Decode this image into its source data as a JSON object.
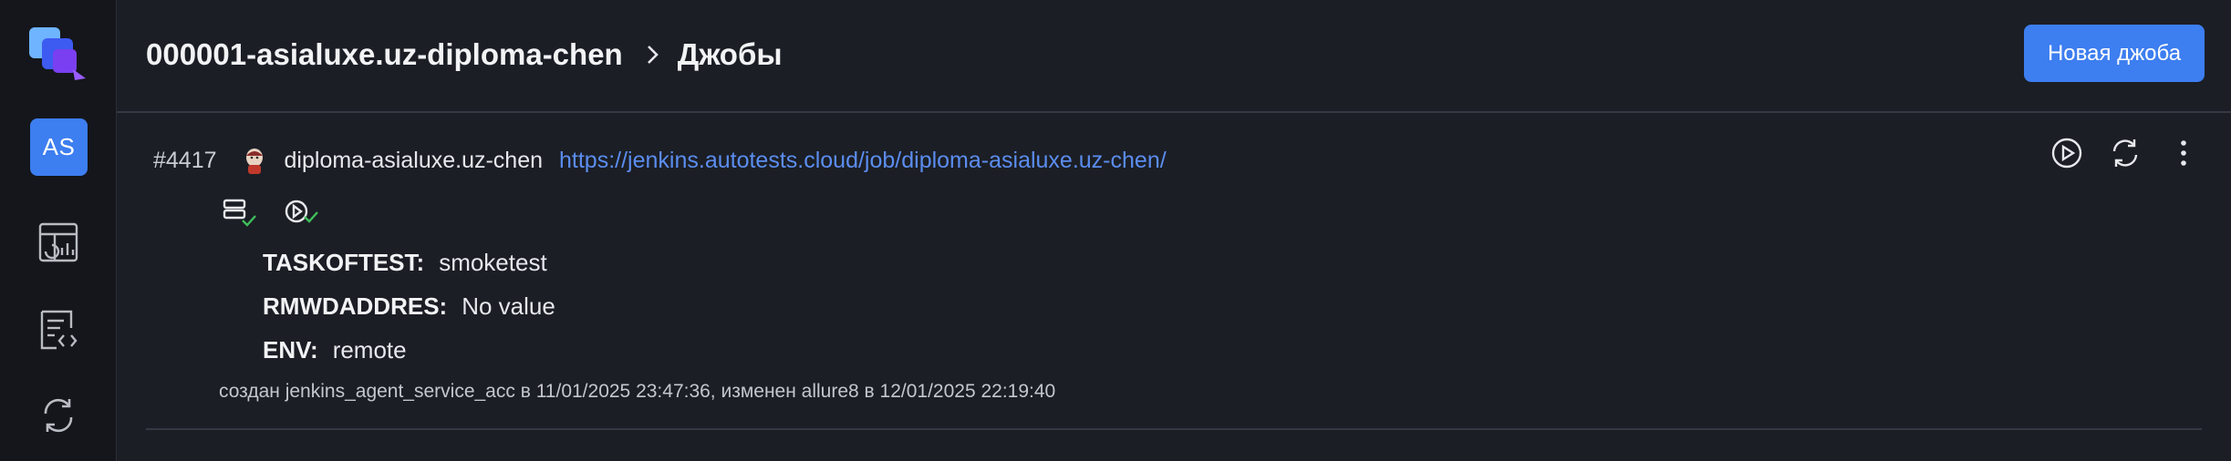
{
  "sidebar": {
    "avatar_initials": "AS",
    "icons": [
      "logo-icon",
      "dashboard-icon",
      "testcases-icon",
      "jobs-sync-icon"
    ]
  },
  "header": {
    "project": "000001-asialuxe.uz-diploma-chen",
    "section": "Джобы",
    "new_job_label": "Новая джоба"
  },
  "job": {
    "number": "#4417",
    "name": "diploma-asialuxe.uz-chen",
    "url": "https://jenkins.autotests.cloud/job/diploma-asialuxe.uz-chen/",
    "params": [
      {
        "key": "TASKOFTEST:",
        "value": "smoketest"
      },
      {
        "key": "RMWDADDRES:",
        "value": "No value"
      },
      {
        "key": "ENV:",
        "value": "remote"
      }
    ],
    "meta": "создан jenkins_agent_service_acc в 11/01/2025 23:47:36, изменен allure8 в 12/01/2025 22:19:40"
  },
  "colors": {
    "accent": "#3d7ef0",
    "link": "#5b8def",
    "check": "#3fbf5a",
    "background": "#1b1e25",
    "sidebar": "#14161b"
  }
}
